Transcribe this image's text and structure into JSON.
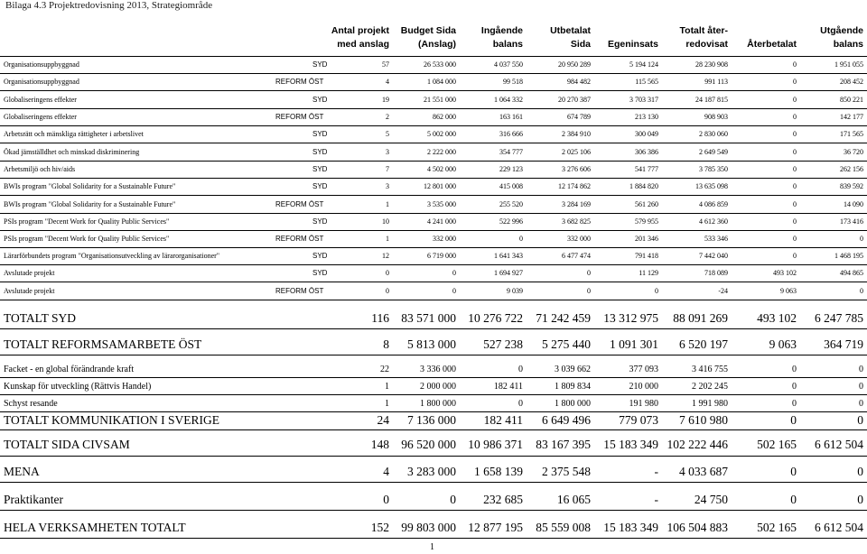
{
  "document": {
    "title": "Bilaga 4.3 Projektredovisning 2013, Strategiområde",
    "page_number": "1"
  },
  "header": {
    "row1": [
      "Antal projekt",
      "Budget Sida",
      "Ingående",
      "Utbetalat",
      "",
      "Totalt åter-",
      "",
      "Utgående"
    ],
    "row2": [
      "med anslag",
      "(Anslag)",
      "balans",
      "Sida",
      "Egeninsats",
      "redovisat",
      "Återbetalat",
      "balans"
    ]
  },
  "rows": [
    {
      "label": "Organisationsuppbyggnad",
      "region": "SYD",
      "values": [
        "57",
        "26 533 000",
        "4 037 550",
        "20 950 289",
        "5 194 124",
        "28 230 908",
        "0",
        "1 951 055"
      ]
    },
    {
      "label": "Organisationsuppbyggnad",
      "region": "REFORM ÖST",
      "values": [
        "4",
        "1 084 000",
        "99 518",
        "984 482",
        "115 565",
        "991 113",
        "0",
        "208 452"
      ]
    },
    {
      "label": "Globaliseringens effekter",
      "region": "SYD",
      "values": [
        "19",
        "21 551 000",
        "1 064 332",
        "20 270 387",
        "3 703 317",
        "24 187 815",
        "0",
        "850 221"
      ]
    },
    {
      "label": "Globaliseringens effekter",
      "region": "REFORM ÖST",
      "values": [
        "2",
        "862 000",
        "163 161",
        "674 789",
        "213 130",
        "908 903",
        "0",
        "142 177"
      ]
    },
    {
      "label": "Arbetsrätt och mänskliga rättigheter i arbetslivet",
      "region": "SYD",
      "values": [
        "5",
        "5 002 000",
        "316 666",
        "2 384 910",
        "300 049",
        "2 830 060",
        "0",
        "171 565"
      ]
    },
    {
      "label": "Ökad jämställdhet och minskad diskriminering",
      "region": "SYD",
      "values": [
        "3",
        "2 222 000",
        "354 777",
        "2 025 106",
        "306 386",
        "2 649 549",
        "0",
        "36 720"
      ]
    },
    {
      "label": "Arbetsmiljö och hiv/aids",
      "region": "SYD",
      "values": [
        "7",
        "4 502 000",
        "229 123",
        "3 276 606",
        "541 777",
        "3 785 350",
        "0",
        "262 156"
      ]
    },
    {
      "label": "BWIs program \"Global Solidarity for a Sustainable Future\"",
      "region": "SYD",
      "values": [
        "3",
        "12 801 000",
        "415 008",
        "12 174 862",
        "1 884 820",
        "13 635 098",
        "0",
        "839 592"
      ]
    },
    {
      "label": "BWIs program \"Global Solidarity for a Sustainable Future\"",
      "region": "REFORM ÖST",
      "values": [
        "1",
        "3 535 000",
        "255 520",
        "3 284 169",
        "561 260",
        "4 086 859",
        "0",
        "14 090"
      ]
    },
    {
      "label": "PSIs program \"Decent Work for Quality Public Services\"",
      "region": "SYD",
      "values": [
        "10",
        "4 241 000",
        "522 996",
        "3 682 825",
        "579 955",
        "4 612 360",
        "0",
        "173 416"
      ]
    },
    {
      "label": "PSIs program \"Decent Work for Quality Public Services\"",
      "region": "REFORM ÖST",
      "values": [
        "1",
        "332 000",
        "0",
        "332 000",
        "201 346",
        "533 346",
        "0",
        "0"
      ]
    },
    {
      "label": "Lärarförbundets program \"Organisationsutveckling av lärarorganisationer\"",
      "region": "SYD",
      "values": [
        "12",
        "6 719 000",
        "1 641 343",
        "6 477 474",
        "791 418",
        "7 442 040",
        "0",
        "1 468 195"
      ]
    },
    {
      "label": "Avslutade projekt",
      "region": "SYD",
      "values": [
        "0",
        "0",
        "1 694 927",
        "0",
        "11 129",
        "718 089",
        "493 102",
        "494 865"
      ]
    },
    {
      "label": "Avslutade projekt",
      "region": "REFORM ÖST",
      "values": [
        "0",
        "0",
        "9 039",
        "0",
        "0",
        "-24",
        "9 063",
        "0"
      ]
    }
  ],
  "totals_syd_reform": [
    {
      "label": "TOTALT SYD",
      "values": [
        "116",
        "83 571 000",
        "10 276 722",
        "71 242 459",
        "13 312 975",
        "88 091 269",
        "493 102",
        "6 247 785"
      ]
    },
    {
      "label": "TOTALT REFORMSAMARBETE ÖST",
      "values": [
        "8",
        "5 813 000",
        "527 238",
        "5 275 440",
        "1 091 301",
        "6 520 197",
        "9 063",
        "364 719"
      ]
    }
  ],
  "kommunikation_rows": [
    {
      "label": "Facket - en global förändrande kraft",
      "values": [
        "22",
        "3 336 000",
        "0",
        "3 039 662",
        "377 093",
        "3 416 755",
        "0",
        "0"
      ]
    },
    {
      "label": "Kunskap för utveckling (Rättvis Handel)",
      "values": [
        "1",
        "2 000 000",
        "182 411",
        "1 809 834",
        "210 000",
        "2 202 245",
        "0",
        "0"
      ]
    },
    {
      "label": "Schyst resande",
      "values": [
        "1",
        "1 800 000",
        "0",
        "1 800 000",
        "191 980",
        "1 991 980",
        "0",
        "0"
      ]
    }
  ],
  "totalt_kommunikation": {
    "label": "TOTALT KOMMUNIKATION I SVERIGE",
    "values": [
      "24",
      "7 136 000",
      "182 411",
      "6 649 496",
      "779 073",
      "7 610 980",
      "0",
      "0"
    ]
  },
  "totalt_sida": {
    "label": "TOTALT SIDA CIVSAM",
    "values": [
      "148",
      "96 520 000",
      "10 986 371",
      "83 167 395",
      "15 183 349",
      "102 222 446",
      "502 165",
      "6 612 504"
    ]
  },
  "mena": {
    "label": "MENA",
    "values": [
      "4",
      "3 283 000",
      "1 658 139",
      "2 375 548",
      "-",
      "4 033 687",
      "0",
      "0"
    ]
  },
  "praktikanter": {
    "label": "Praktikanter",
    "values": [
      "0",
      "0",
      "232 685",
      "16 065",
      "-",
      "24 750",
      "0",
      "0"
    ]
  },
  "hela": {
    "label": "HELA VERKSAMHETEN TOTALT",
    "values": [
      "152",
      "99 803 000",
      "12 877 195",
      "85 559 008",
      "15 183 349",
      "106 504 883",
      "502 165",
      "6 612 504"
    ]
  }
}
